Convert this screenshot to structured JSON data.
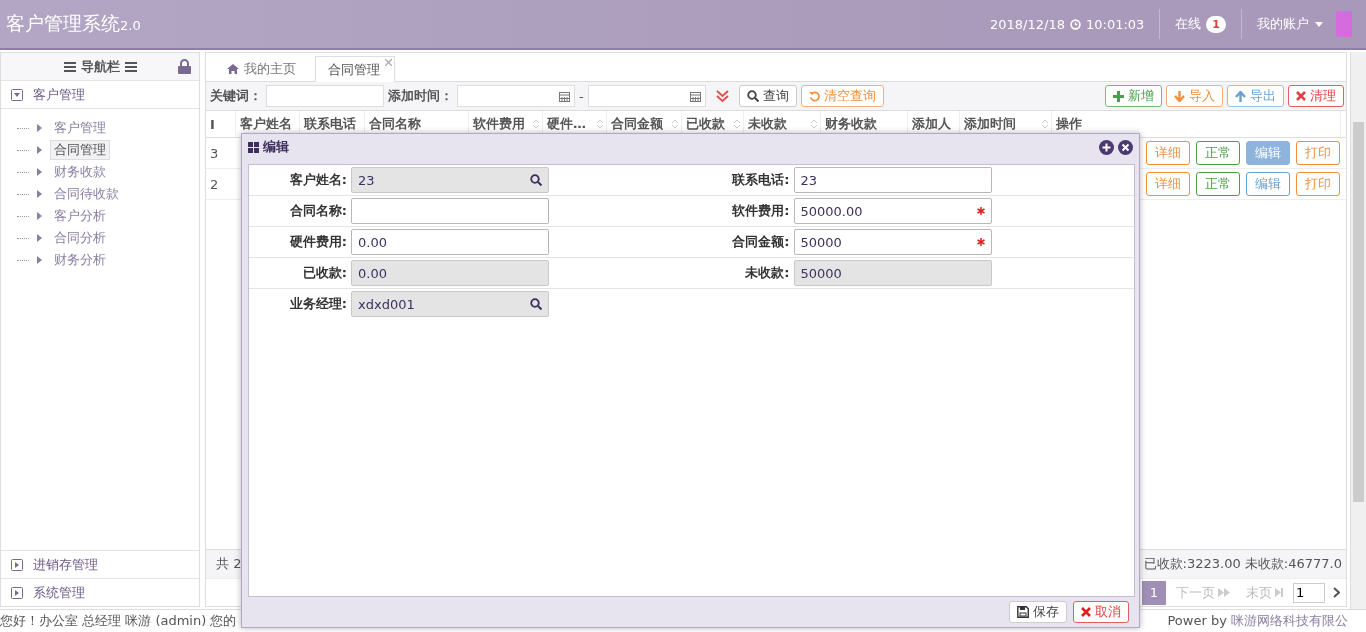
{
  "header": {
    "title": "客户管理系统",
    "version": "2.0",
    "date": "2018/12/18",
    "time": "10:01:03",
    "online_label": "在线",
    "online_count": "1",
    "account": "我的账户"
  },
  "sidebar": {
    "title": "导航栏",
    "sections": [
      {
        "label": "客户管理",
        "expanded": true,
        "children": [
          {
            "label": "客户管理",
            "selected": false
          },
          {
            "label": "合同管理",
            "selected": true
          },
          {
            "label": "财务收款",
            "selected": false
          },
          {
            "label": "合同待收款",
            "selected": false
          },
          {
            "label": "客户分析",
            "selected": false
          },
          {
            "label": "合同分析",
            "selected": false
          },
          {
            "label": "财务分析",
            "selected": false
          }
        ]
      },
      {
        "label": "进销存管理",
        "expanded": false
      },
      {
        "label": "系统管理",
        "expanded": false
      }
    ]
  },
  "tabs": [
    {
      "label": "我的主页",
      "selected": false,
      "closable": false
    },
    {
      "label": "合同管理",
      "selected": true,
      "closable": true
    }
  ],
  "toolbar": {
    "keyword_label": "关键词：",
    "date_label": "添加时间：",
    "date_separator": "-",
    "search": "查询",
    "clear": "清空查询",
    "actions": [
      {
        "label": "新增",
        "kind": "add"
      },
      {
        "label": "导入",
        "kind": "import"
      },
      {
        "label": "导出",
        "kind": "export"
      },
      {
        "label": "清理",
        "kind": "clean"
      }
    ]
  },
  "table": {
    "columns": [
      {
        "label": "I",
        "sortable": false
      },
      {
        "label": "客户姓名",
        "sortable": false
      },
      {
        "label": "联系电话",
        "sortable": false
      },
      {
        "label": "合同名称",
        "sortable": false
      },
      {
        "label": "软件费用",
        "sortable": true
      },
      {
        "label": "硬件…",
        "sortable": true
      },
      {
        "label": "合同金额",
        "sortable": true
      },
      {
        "label": "已收款",
        "sortable": true
      },
      {
        "label": "未收款",
        "sortable": true
      },
      {
        "label": "财务收款",
        "sortable": false
      },
      {
        "label": "添加人",
        "sortable": false
      },
      {
        "label": "添加时间",
        "sortable": true
      },
      {
        "label": "操作",
        "sortable": false
      }
    ],
    "rows": [
      {
        "id": "3",
        "actions": [
          {
            "label": "详细",
            "kind": "detail",
            "active": false
          },
          {
            "label": "正常",
            "kind": "status",
            "active": false
          },
          {
            "label": "编辑",
            "kind": "edit",
            "active": true
          },
          {
            "label": "打印",
            "kind": "print",
            "active": false
          }
        ]
      },
      {
        "id": "2",
        "actions": [
          {
            "label": "详细",
            "kind": "detail",
            "active": false
          },
          {
            "label": "正常",
            "kind": "status",
            "active": false
          },
          {
            "label": "编辑",
            "kind": "edit",
            "active": false
          },
          {
            "label": "打印",
            "kind": "print",
            "active": false
          }
        ]
      }
    ]
  },
  "footer": {
    "total": "共 2",
    "summary": "已收款:3223.00 未收款:46777.0",
    "pages": [
      {
        "label": "1",
        "selected": true
      }
    ],
    "next": "下一页",
    "last": "末页",
    "page_input": "1"
  },
  "status_bar": {
    "left": "您好！办公室 总经理 咪游 (admin) 您的",
    "right_prefix": "Power by",
    "right_company": "咪游网络科技有限公"
  },
  "dialog": {
    "title": "编辑",
    "left_fields": [
      {
        "label": "客户姓名:",
        "value": "23",
        "readonly": true,
        "required": false,
        "lookup": true
      },
      {
        "label": "合同名称:",
        "readonly": false,
        "required": false,
        "lookup": false
      },
      {
        "label": "硬件费用:",
        "value": "0.00",
        "readonly": false,
        "required": false,
        "lookup": false
      },
      {
        "label": "已收款:",
        "value": "0.00",
        "readonly": true,
        "required": false,
        "lookup": false
      },
      {
        "label": "业务经理:",
        "value": "xdxd001",
        "readonly": true,
        "required": false,
        "lookup": true
      }
    ],
    "right_fields": [
      {
        "label": "联系电话:",
        "value": "23",
        "readonly": false,
        "required": false,
        "lookup": false
      },
      {
        "label": "软件费用:",
        "value": "50000.00",
        "readonly": false,
        "required": true,
        "lookup": false
      },
      {
        "label": "合同金额:",
        "value": "50000",
        "readonly": false,
        "required": true,
        "lookup": false
      },
      {
        "label": "未收款:",
        "value": "50000",
        "readonly": true,
        "required": false,
        "lookup": false
      }
    ],
    "save": "保存",
    "cancel": "取消"
  }
}
